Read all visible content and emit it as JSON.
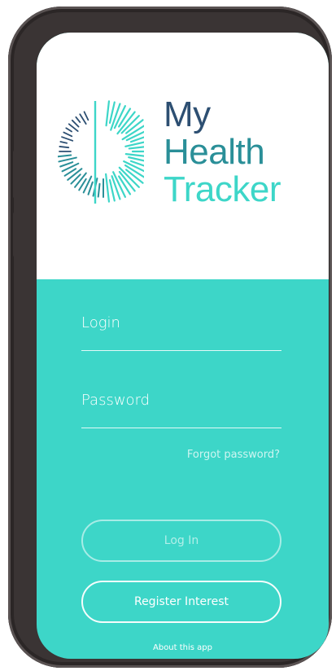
{
  "app": {
    "brand_line1": "My",
    "brand_line2": "Health",
    "brand_line3": "Tracker",
    "logo_icon": "radial-burst-logo-icon"
  },
  "form": {
    "login_label": "Login",
    "password_label": "Password",
    "forgot_password": "Forgot password?"
  },
  "actions": {
    "login_button": "Log In",
    "register_button": "Register Interest",
    "about_link": "About this app"
  },
  "colors": {
    "teal_background": "#3dd6c8",
    "brand_navy": "#2d4f72",
    "brand_teal_dark": "#2a8f98",
    "brand_teal_light": "#3dd6c8",
    "phone_frame": "#3a3434"
  }
}
